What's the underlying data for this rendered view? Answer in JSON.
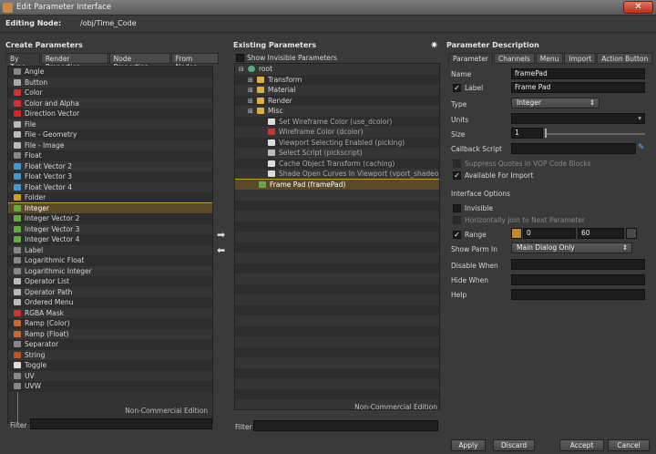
{
  "window": {
    "title": "Edit Parameter Interface",
    "close": "✕"
  },
  "editing": {
    "label": "Editing Node:",
    "path": "/obj/Time_Code"
  },
  "create": {
    "title": "Create Parameters",
    "tabs": [
      "By Type",
      "Render Properties",
      "Node Properties",
      "From Nodes"
    ],
    "items": [
      {
        "label": "Angle",
        "color": "#888"
      },
      {
        "label": "Button",
        "color": "#aaa"
      },
      {
        "label": "Color",
        "color": "#c33"
      },
      {
        "label": "Color and Alpha",
        "color": "#c33"
      },
      {
        "label": "Direction Vector",
        "color": "#d22"
      },
      {
        "label": "File",
        "color": "#bbb"
      },
      {
        "label": "File - Geometry",
        "color": "#bbb"
      },
      {
        "label": "File - Image",
        "color": "#bbb"
      },
      {
        "label": "Float",
        "color": "#888"
      },
      {
        "label": "Float Vector 2",
        "color": "#49c"
      },
      {
        "label": "Float Vector 3",
        "color": "#49c"
      },
      {
        "label": "Float Vector 4",
        "color": "#49c"
      },
      {
        "label": "Folder",
        "color": "#c9a030"
      },
      {
        "label": "Integer",
        "color": "#6a4"
      },
      {
        "label": "Integer Vector 2",
        "color": "#6a4"
      },
      {
        "label": "Integer Vector 3",
        "color": "#6a4"
      },
      {
        "label": "Integer Vector 4",
        "color": "#6a4"
      },
      {
        "label": "Label",
        "color": "#888"
      },
      {
        "label": "Logarithmic Float",
        "color": "#888"
      },
      {
        "label": "Logarithmic Integer",
        "color": "#888"
      },
      {
        "label": "Operator List",
        "color": "#bbb"
      },
      {
        "label": "Operator Path",
        "color": "#bbb"
      },
      {
        "label": "Ordered Menu",
        "color": "#bbb"
      },
      {
        "label": "RGBA Mask",
        "color": "#c33"
      },
      {
        "label": "Ramp (Color)",
        "color": "#c63"
      },
      {
        "label": "Ramp (Float)",
        "color": "#c63"
      },
      {
        "label": "Separator",
        "color": "#888"
      },
      {
        "label": "String",
        "color": "#b52"
      },
      {
        "label": "Toggle",
        "color": "#ddd"
      },
      {
        "label": "UV",
        "color": "#888"
      },
      {
        "label": "UVW",
        "color": "#888"
      }
    ],
    "selected_index": 13,
    "edition": "Non-Commercial Edition",
    "filter_label": "Filter"
  },
  "existing": {
    "title": "Existing Parameters",
    "show_invisible": "Show Invisible Parameters",
    "tree": [
      {
        "label": "root",
        "level": 0,
        "kind": "root"
      },
      {
        "label": "Transform",
        "level": 1,
        "kind": "folder"
      },
      {
        "label": "Material",
        "level": 1,
        "kind": "folder"
      },
      {
        "label": "Render",
        "level": 1,
        "kind": "folder"
      },
      {
        "label": "Misc",
        "level": 1,
        "kind": "folder"
      },
      {
        "label": "Set Wireframe Color (use_dcolor)",
        "level": 2,
        "kind": "toggle"
      },
      {
        "label": "Wireframe Color (dcolor)",
        "level": 2,
        "kind": "color"
      },
      {
        "label": "Viewport Selecting Enabled (picking)",
        "level": 2,
        "kind": "toggle"
      },
      {
        "label": "Select Script (pickscript)",
        "level": 2,
        "kind": "file"
      },
      {
        "label": "Cache Object Transform (caching)",
        "level": 2,
        "kind": "toggle"
      },
      {
        "label": "Shade Open Curves In Viewport (vport_shadeopen)",
        "level": 2,
        "kind": "toggle"
      },
      {
        "label": "Frame Pad (framePad)",
        "level": 1,
        "kind": "int"
      }
    ],
    "selected_index": 11,
    "edition": "Non-Commercial Edition",
    "filter_label": "Filter"
  },
  "desc": {
    "title": "Parameter Description",
    "tabs": [
      "Parameter",
      "Channels",
      "Menu",
      "Import",
      "Action Button"
    ],
    "name_label": "Name",
    "name_value": "framePad",
    "label_label": "Label",
    "label_value": "Frame Pad",
    "type_label": "Type",
    "type_value": "Integer",
    "units_label": "Units",
    "size_label": "Size",
    "size_value": "1",
    "callback_label": "Callback Script",
    "suppress": "Suppress Quotes in VOP Code Blocks",
    "available": "Available For Import",
    "interface_opts": "Interface Options",
    "invisible": "Invisible",
    "horiz": "Horizontally Join to Next Parameter",
    "range_label": "Range",
    "range_min": "0",
    "range_max": "60",
    "show_parm_label": "Show Parm In",
    "show_parm_value": "Main Dialog Only",
    "disable_when": "Disable When",
    "hide_when": "Hide When",
    "help": "Help"
  },
  "buttons": {
    "apply": "Apply",
    "discard": "Discard",
    "accept": "Accept",
    "cancel": "Cancel"
  }
}
